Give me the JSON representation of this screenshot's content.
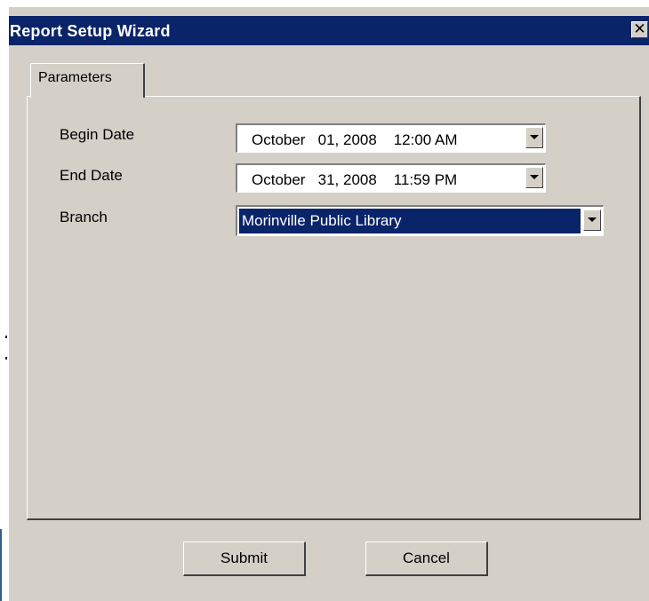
{
  "window": {
    "title": "Report Setup Wizard",
    "close_label": "✕",
    "titlebar_color": "#0a246a",
    "face_color": "#d4d0c8"
  },
  "tabs": [
    {
      "label": "Parameters",
      "selected": true
    }
  ],
  "fields": {
    "begin_date": {
      "label": "Begin Date",
      "value": "October   01, 2008    12:00 AM"
    },
    "end_date": {
      "label": "End Date",
      "value": "October   31, 2008    11:59 PM"
    },
    "branch": {
      "label": "Branch",
      "value": "Morinville Public Library"
    }
  },
  "buttons": {
    "submit": "Submit",
    "cancel": "Cancel"
  },
  "icons": {
    "dropdown": "chevron-down-icon",
    "close": "close-icon"
  }
}
